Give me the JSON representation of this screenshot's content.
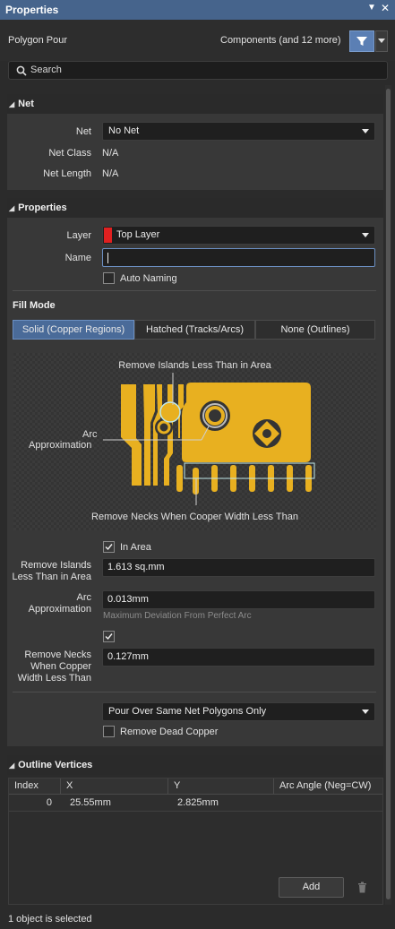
{
  "window": {
    "title": "Properties",
    "pin_icon": "pin-icon",
    "close_icon": "close-icon"
  },
  "header": {
    "object_type": "Polygon Pour",
    "filter_summary": "Components (and 12 more)"
  },
  "search": {
    "placeholder": "Search"
  },
  "net_section": {
    "title": "Net",
    "net_label": "Net",
    "net_value": "No Net",
    "net_class_label": "Net Class",
    "net_class_value": "N/A",
    "net_length_label": "Net Length",
    "net_length_value": "N/A"
  },
  "properties_section": {
    "title": "Properties",
    "layer_label": "Layer",
    "layer_value": "Top Layer",
    "layer_color": "#e02020",
    "name_label": "Name",
    "name_value": "",
    "auto_naming_label": "Auto Naming",
    "auto_naming_checked": false
  },
  "fill_mode": {
    "title": "Fill Mode",
    "options": [
      "Solid (Copper Regions)",
      "Hatched (Tracks/Arcs)",
      "None (Outlines)"
    ],
    "selected": "Solid (Copper Regions)"
  },
  "diagram": {
    "label_islands": "Remove Islands Less Than in Area",
    "label_arc_line1": "Arc",
    "label_arc_line2": "Approximation",
    "label_necks": "Remove Necks When Cooper Width Less Than",
    "copper_color": "#e8b020"
  },
  "solid_options": {
    "in_area_label": "In Area",
    "in_area_checked": true,
    "remove_islands_label_1": "Remove Islands",
    "remove_islands_label_2": "Less Than in Area",
    "remove_islands_value": "1.613 sq.mm",
    "arc_label_1": "Arc",
    "arc_label_2": "Approximation",
    "arc_value": "0.013mm",
    "arc_hint": "Maximum Deviation From Perfect Arc",
    "necks_checked": true,
    "necks_label_1": "Remove Necks",
    "necks_label_2": "When Copper",
    "necks_label_3": "Width Less Than",
    "necks_value": "0.127mm",
    "pour_over_value": "Pour Over Same Net Polygons Only",
    "remove_dead_copper_label": "Remove Dead Copper",
    "remove_dead_copper_checked": false
  },
  "outline_vertices": {
    "title": "Outline Vertices",
    "columns": [
      "Index",
      "X",
      "Y",
      "Arc Angle (Neg=CW)"
    ],
    "rows": [
      {
        "index": "0",
        "x": "25.55mm",
        "y": "2.825mm",
        "arc": ""
      }
    ],
    "add_label": "Add",
    "delete_icon": "trash-icon"
  },
  "status": {
    "text": "1 object is selected"
  }
}
